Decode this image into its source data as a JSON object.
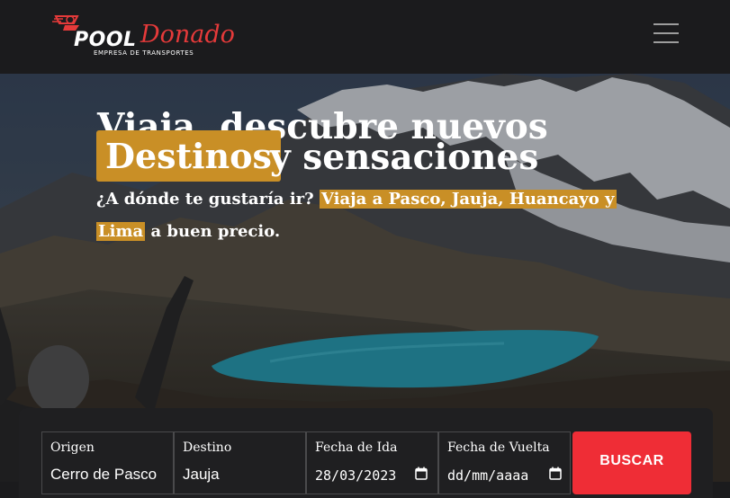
{
  "brand": {
    "name_part1": "POOL",
    "name_part2": "Donado",
    "tagline": "EMPRESA DE TRANSPORTES",
    "accent": "#e53a3a"
  },
  "nav": {
    "menu_icon": "hamburger-menu-icon"
  },
  "hero": {
    "title_line1": "Viaja, descubre nuevos",
    "highlight_word": "Destinos",
    "title_line2_rest": "y sensaciones",
    "subtitle_prefix": "¿A dónde te gustaría ir?",
    "subtitle_highlight1": "Viaja a Pasco, Jauja, Huancayo y",
    "subtitle_highlight2": "Lima",
    "subtitle_suffix": "a buen precio.",
    "highlight_color": "#c98f26"
  },
  "search": {
    "origin": {
      "label": "Origen",
      "value": "Cerro de Pasco"
    },
    "destination": {
      "label": "Destino",
      "value": "Jauja"
    },
    "departure": {
      "label": "Fecha de Ida",
      "value": "28/03/2023"
    },
    "return": {
      "label": "Fecha de Vuelta",
      "value": "dd/mm/aaaa"
    },
    "button_label": "BUSCAR",
    "button_color": "#ef2d36"
  }
}
